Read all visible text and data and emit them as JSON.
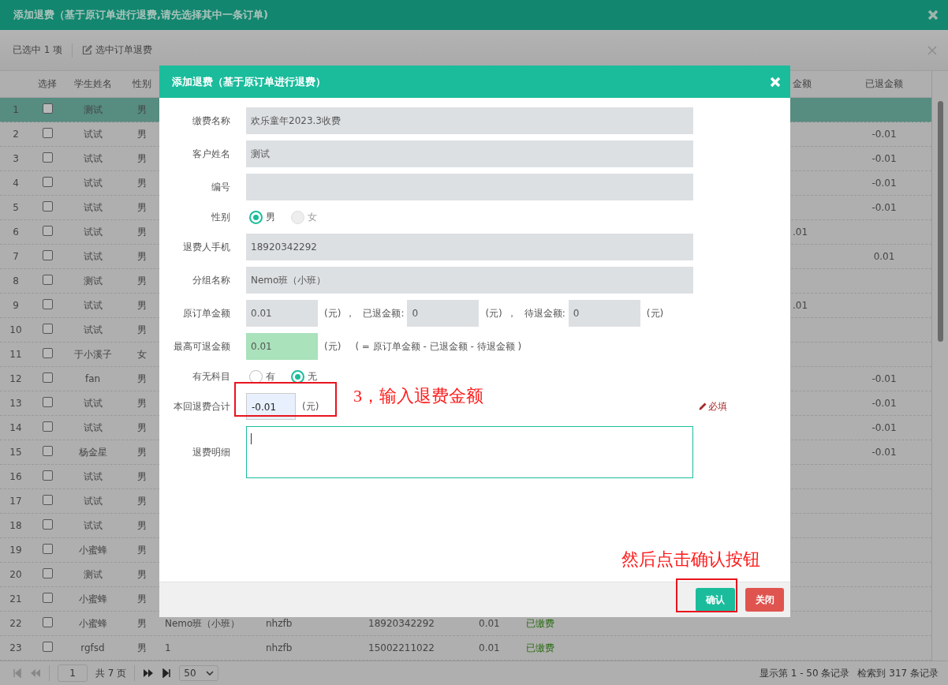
{
  "window": {
    "title": "添加退费（基于原订单进行退费,请先选择其中一条订单)"
  },
  "toolbar": {
    "selection": "已选中 1 项",
    "action": "选中订单退费"
  },
  "table": {
    "columns": {
      "select": "选择",
      "student_name": "学生姓名",
      "gender": "性别",
      "column_10": "金额",
      "refunded": "已退金额"
    },
    "rows": [
      {
        "no": "1",
        "checked": false,
        "selected": true,
        "name": "测试",
        "gender": "男"
      },
      {
        "no": "2",
        "checked": false,
        "selected": false,
        "name": "试试",
        "gender": "男",
        "refunded": "-0.01"
      },
      {
        "no": "3",
        "checked": false,
        "selected": false,
        "name": "试试",
        "gender": "男",
        "refunded": "-0.01"
      },
      {
        "no": "4",
        "checked": false,
        "selected": false,
        "name": "试试",
        "gender": "男",
        "refunded": "-0.01"
      },
      {
        "no": "5",
        "checked": false,
        "selected": false,
        "name": "试试",
        "gender": "男",
        "refunded": "-0.01"
      },
      {
        "no": "6",
        "checked": false,
        "selected": false,
        "name": "试试",
        "gender": "男",
        "column_10": ".01"
      },
      {
        "no": "7",
        "checked": false,
        "selected": false,
        "name": "试试",
        "gender": "男",
        "refunded": "0.01"
      },
      {
        "no": "8",
        "checked": false,
        "selected": false,
        "name": "测试",
        "gender": "男"
      },
      {
        "no": "9",
        "checked": false,
        "selected": false,
        "name": "试试",
        "gender": "男",
        "column_10": ".01"
      },
      {
        "no": "10",
        "checked": false,
        "selected": false,
        "name": "试试",
        "gender": "男"
      },
      {
        "no": "11",
        "checked": false,
        "selected": false,
        "name": "于小溪子",
        "gender": "女"
      },
      {
        "no": "12",
        "checked": false,
        "selected": false,
        "name": "fan",
        "gender": "男",
        "refunded": "-0.01"
      },
      {
        "no": "13",
        "checked": false,
        "selected": false,
        "name": "试试",
        "gender": "男",
        "refunded": "-0.01"
      },
      {
        "no": "14",
        "checked": false,
        "selected": false,
        "name": "试试",
        "gender": "男",
        "refunded": "-0.01"
      },
      {
        "no": "15",
        "checked": false,
        "selected": false,
        "name": "杨金星",
        "gender": "男",
        "refunded": "-0.01"
      },
      {
        "no": "16",
        "checked": false,
        "selected": false,
        "name": "试试",
        "gender": "男"
      },
      {
        "no": "17",
        "checked": false,
        "selected": false,
        "name": "试试",
        "gender": "男"
      },
      {
        "no": "18",
        "checked": false,
        "selected": false,
        "name": "试试",
        "gender": "男"
      },
      {
        "no": "19",
        "checked": false,
        "selected": false,
        "name": "小蜜蜂",
        "gender": "男"
      },
      {
        "no": "20",
        "checked": false,
        "selected": false,
        "name": "测试",
        "gender": "男"
      },
      {
        "no": "21",
        "checked": false,
        "selected": false,
        "name": "小蜜蜂",
        "gender": "男"
      },
      {
        "no": "22",
        "checked": false,
        "selected": false,
        "name": "小蜜蜂",
        "gender": "男",
        "column_5": "Nemo班（小班）",
        "column_6": "nhzfb",
        "column_7": "18920342292",
        "column_8": "0.01",
        "column_9": "已缴费"
      },
      {
        "no": "23",
        "checked": false,
        "selected": false,
        "name": "rgfsd",
        "gender": "男",
        "column_5": "1",
        "column_6": "nhzfb",
        "column_7": "15002211022",
        "column_8": "0.01",
        "column_9": "已缴费"
      }
    ]
  },
  "pager": {
    "page": "1",
    "total_pages": "共 7 页",
    "page_size": "50",
    "range": "显示第 1 - 50 条记录",
    "total": "检索到 317 条记录"
  },
  "dialog": {
    "title": "添加退费（基于原订单进行退费）",
    "fields": [
      {
        "kind": "text",
        "label": "缴费名称",
        "value": "欢乐童年2023.3收费"
      },
      {
        "kind": "text",
        "label": "客户姓名",
        "value": "测试"
      },
      {
        "kind": "text",
        "label": "编号"
      },
      {
        "kind": "radio",
        "label": "性别",
        "options": [
          {
            "label": "男",
            "selected": true,
            "disabled": false
          },
          {
            "label": "女",
            "selected": false,
            "disabled": true
          }
        ]
      },
      {
        "kind": "text",
        "label": "退费人手机",
        "value": "18920342292"
      },
      {
        "kind": "text",
        "label": "分组名称",
        "value": "Nemo班（小班）"
      },
      {
        "kind": "split",
        "label": "原订单金额",
        "parts": [
          {
            "value": "0.01",
            "unit": "(元)",
            "sep": "，"
          },
          {
            "label": "已退金额:",
            "value": "0",
            "unit": "(元)",
            "sep": "，"
          },
          {
            "label": "待退金额:",
            "value": "0",
            "unit": "(元)"
          }
        ]
      },
      {
        "kind": "max",
        "label": "最高可退金额",
        "value": "0.01",
        "unit": "(元)",
        "note": "( = 原订单金额 - 已退金额 - 待退金额 )"
      },
      {
        "kind": "radio",
        "label": "有无科目",
        "options": [
          {
            "label": "有",
            "selected": false,
            "disabled": false
          },
          {
            "label": "无",
            "selected": true,
            "disabled": false
          }
        ]
      },
      {
        "kind": "amount",
        "label": "本回退费合计",
        "value": "-0.01",
        "unit": "(元)",
        "required": "必填"
      },
      {
        "kind": "textarea",
        "label": "退费明细",
        "focused": true
      }
    ],
    "buttons": [
      {
        "label": "确认",
        "kind": "primary"
      },
      {
        "label": "关闭",
        "kind": "danger"
      }
    ],
    "annotations": [
      {
        "text": "3，输入退费金额"
      },
      {
        "text": "然后点击确认按钮"
      }
    ]
  }
}
